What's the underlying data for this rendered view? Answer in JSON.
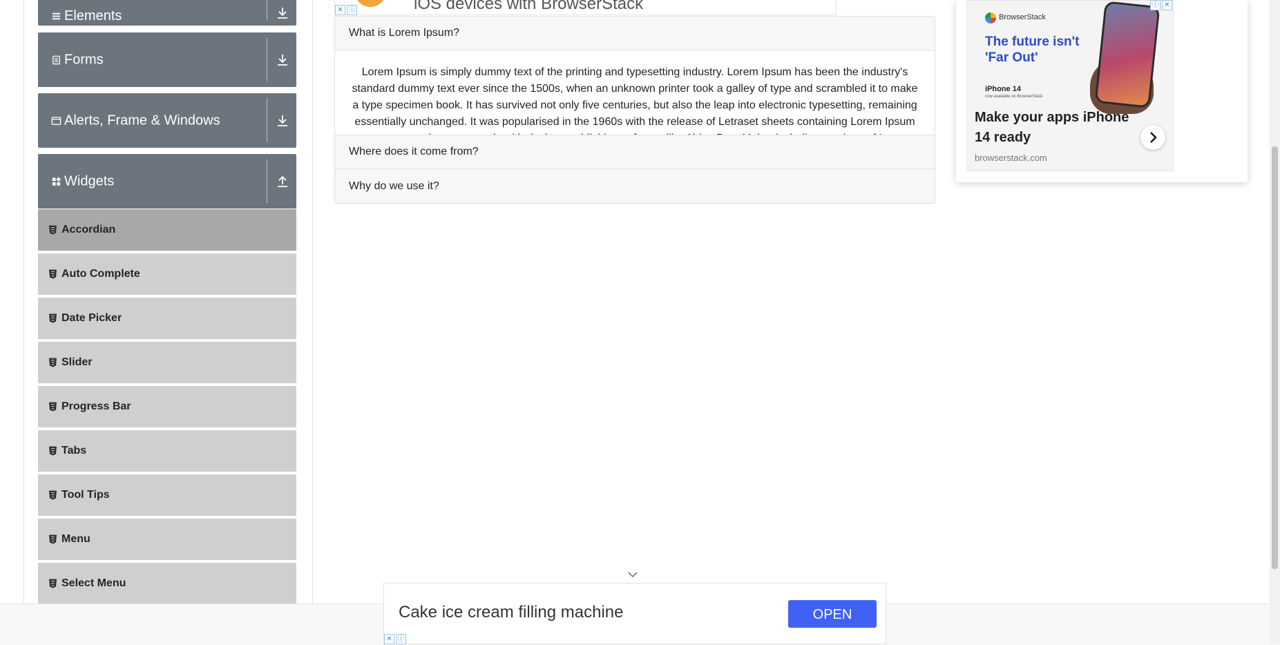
{
  "sidebar": {
    "groups": [
      {
        "title": "Elements",
        "icon": "list-icon"
      },
      {
        "title": "Forms",
        "icon": "document-icon"
      },
      {
        "title": "Alerts, Frame & Windows",
        "icon": "window-icon"
      },
      {
        "title": "Widgets",
        "icon": "widgets-icon"
      }
    ],
    "items": [
      {
        "label": "Accordian",
        "active": true
      },
      {
        "label": "Auto Complete"
      },
      {
        "label": "Date Picker"
      },
      {
        "label": "Slider"
      },
      {
        "label": "Progress Bar"
      },
      {
        "label": "Tabs"
      },
      {
        "label": "Tool Tips"
      },
      {
        "label": "Menu"
      },
      {
        "label": "Select Menu"
      }
    ]
  },
  "top_ad": {
    "text": "iOS devices with BrowserStack"
  },
  "accordion": {
    "sections": [
      {
        "title": "What is Lorem Ipsum?",
        "expanded": true,
        "body": "Lorem Ipsum is simply dummy text of the printing and typesetting industry. Lorem Ipsum has been the industry's standard dummy text ever since the 1500s, when an unknown printer took a galley of type and scrambled it to make a type specimen book. It has survived not only five centuries, but also the leap into electronic typesetting, remaining essentially unchanged. It was popularised in the 1960s with the release of Letraset sheets containing Lorem Ipsum passages, and more recently with desktop publishing software like Aldus PageMaker including versions of Lorem Ipsum."
      },
      {
        "title": "Where does it come from?",
        "expanded": false
      },
      {
        "title": "Why do we use it?",
        "expanded": false
      }
    ]
  },
  "right_ad": {
    "brand": "BrowserStack",
    "headline": "The future isn't 'Far Out'",
    "product": "iPhone 14",
    "product_sub": "now available on BrowserStack",
    "cta": "Make your apps iPhone 14 ready",
    "domain": "browserstack.com",
    "accent": "#2a4bd0"
  },
  "bottom_ad": {
    "text": "Cake ice cream filling machine",
    "button": "OPEN",
    "button_color": "#4062f4"
  },
  "colors": {
    "group_header": "#6c757d",
    "menu_item": "#cfcfcf",
    "menu_item_active": "#a8a8a8"
  }
}
